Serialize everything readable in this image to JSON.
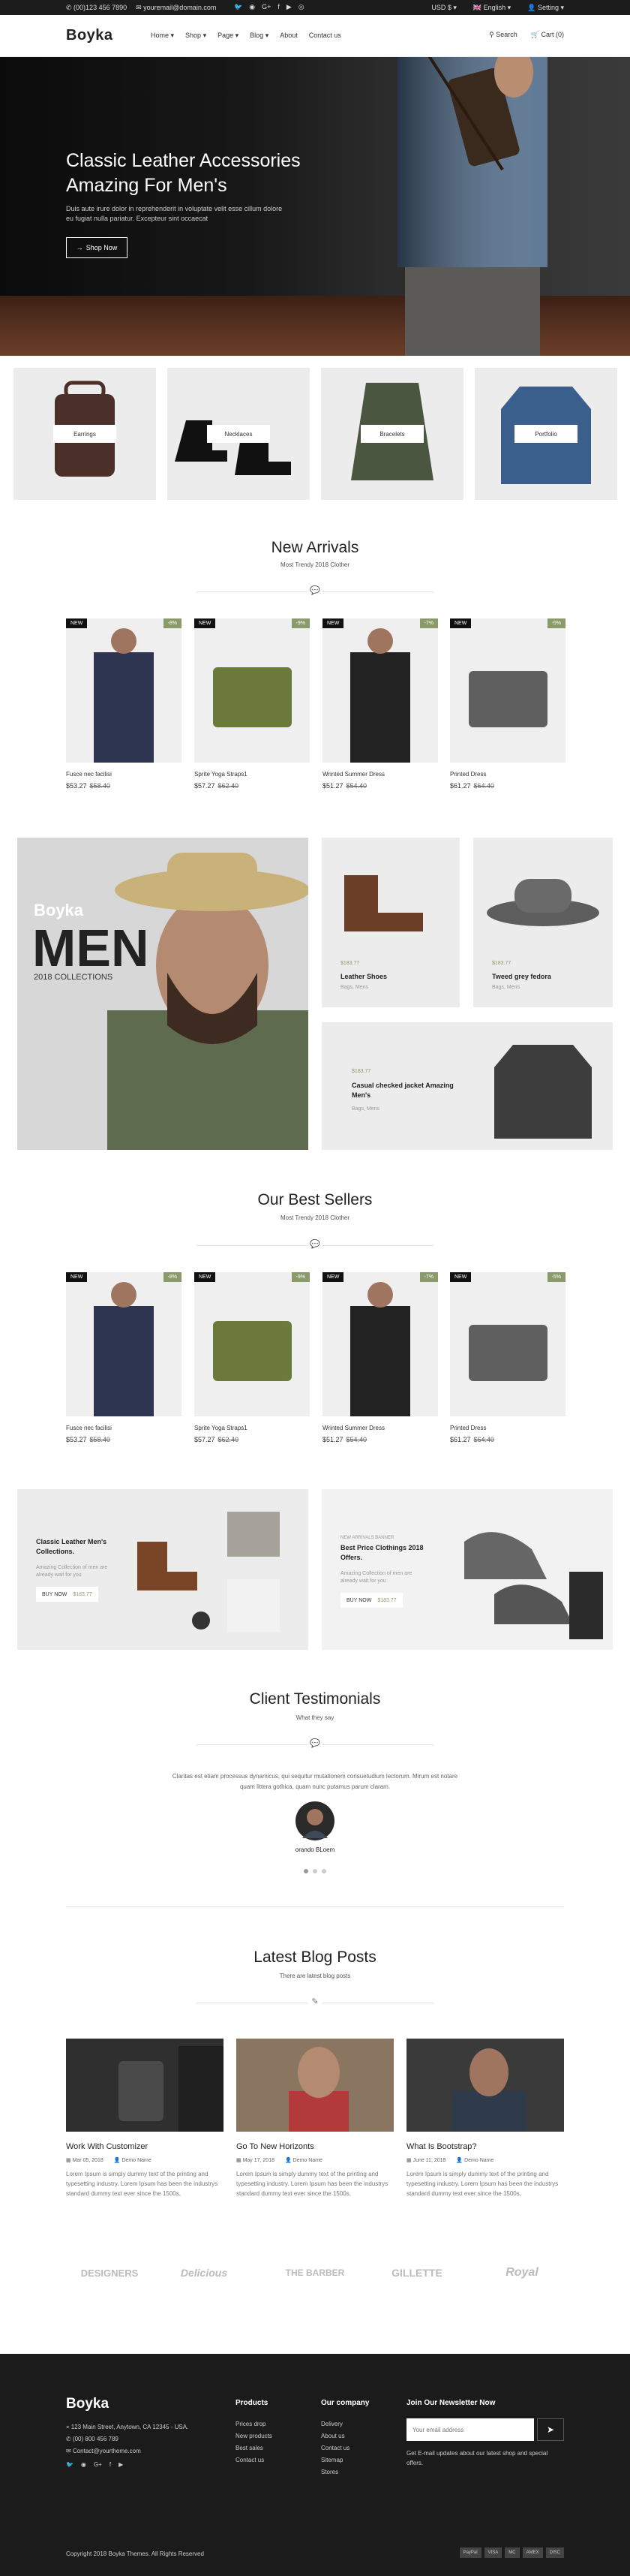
{
  "topbar": {
    "phone": "(00)123 456 7890",
    "email": "youremail@domain.com",
    "currency": "USD $",
    "language": "English",
    "setting": "Setting"
  },
  "header": {
    "logo": "Boyka",
    "nav": [
      "Home",
      "Shop",
      "Page",
      "Blog",
      "About",
      "Contact us"
    ],
    "search": "Search",
    "cart": "Cart (0)"
  },
  "hero": {
    "title": "Classic Leather Accessories Amazing For Men's",
    "text": "Duis aute irure dolor in reprehenderit in voluptate velit esse cillum dolore eu fugiat nulla pariatur. Excepteur sint occaecat",
    "button": "Shop Now"
  },
  "categories": [
    "Earrings",
    "Necklaces",
    "Bracelets",
    "Portfolio"
  ],
  "new_arrivals": {
    "title": "New Arrivals",
    "subtitle": "Most Trendy 2018 Clother",
    "products": [
      {
        "name": "Fusce nec facilisi",
        "price": "$53.27",
        "old": "$58.40",
        "badge": "NEW",
        "off": "-8%"
      },
      {
        "name": "Sprite Yoga Straps1",
        "price": "$57.27",
        "old": "$62.40",
        "badge": "NEW",
        "off": "-9%"
      },
      {
        "name": "Wrinted Summer Dress",
        "price": "$51.27",
        "old": "$54.40",
        "badge": "NEW",
        "off": "-7%"
      },
      {
        "name": "Printed Dress",
        "price": "$61.27",
        "old": "$64.40",
        "badge": "NEW",
        "off": "-5%"
      }
    ]
  },
  "men_banner": {
    "brand": "Boyka",
    "word": "MEN",
    "sub": "2018 COLLECTIONS"
  },
  "promos": [
    {
      "price": "$183.77",
      "title": "Leather Shoes",
      "sub": "Bags, Mens"
    },
    {
      "price": "$183.77",
      "title": "Tweed grey fedora",
      "sub": "Bags, Mens"
    },
    {
      "price": "$183.77",
      "title": "Casual checked jacket Amazing Men's",
      "sub": "Bags, Mens"
    }
  ],
  "best_sellers": {
    "title": "Our Best Sellers",
    "subtitle": "Most Trendy 2018 Clother",
    "products": [
      {
        "name": "Fusce nec facilisi",
        "price": "$53.27",
        "old": "$58.40",
        "badge": "NEW",
        "off": "-8%"
      },
      {
        "name": "Sprite Yoga Straps1",
        "price": "$57.27",
        "old": "$62.40",
        "badge": "NEW",
        "off": "-9%"
      },
      {
        "name": "Wrinted Summer Dress",
        "price": "$51.27",
        "old": "$54.40",
        "badge": "NEW",
        "off": "-7%"
      },
      {
        "name": "Printed Dress",
        "price": "$61.27",
        "old": "$64.40",
        "badge": "NEW",
        "off": "-5%"
      }
    ]
  },
  "offers": [
    {
      "title": "Classic Leather Men's Collections.",
      "text": "Amazing Collection of men are already wait for you",
      "button": "BUY NOW",
      "price": "$183.77",
      "kicker": ""
    },
    {
      "title": "Best Price Clothings 2018 Offers.",
      "text": "Amazing Collection of men are already wait for you",
      "button": "BUY NOW",
      "price": "$183.77",
      "kicker": "NEW ARRIVALS BANNER"
    }
  ],
  "testimonials": {
    "title": "Client Testimonials",
    "subtitle": "What they say",
    "quote": "Claritas est etiam processus dynamicus, qui sequitur mutationem consuetudium lectorum. Mirum est notare quam littera gothica, quam nunc putamus parum claram.",
    "author": "orando BLoem"
  },
  "blog": {
    "title": "Latest Blog Posts",
    "subtitle": "There are latest blog posts",
    "posts": [
      {
        "title": "Work With Customizer",
        "date": "Mar 05, 2018",
        "author": "Demo Name",
        "excerpt": "Lorem Ipsum is simply dummy text of the printing and typesetting industry. Lorem Ipsum has been the industrys standard dummy text ever since the 1500s,"
      },
      {
        "title": "Go To New Horizonts",
        "date": "May 17, 2018",
        "author": "Demo Name",
        "excerpt": "Lorem Ipsum is simply dummy text of the printing and typesetting industry. Lorem Ipsum has been the industrys standard dummy text ever since the 1500s,"
      },
      {
        "title": "What Is Bootstrap?",
        "date": "June 11, 2018",
        "author": "Demo Name",
        "excerpt": "Lorem Ipsum is simply dummy text of the printing and typesetting industry. Lorem Ipsum has been the industrys standard dummy text ever since the 1500s,"
      }
    ]
  },
  "brands": [
    "DESIGNERS",
    "Delicious",
    "THE BARBER",
    "GILLETTE",
    "Royal"
  ],
  "footer": {
    "logo": "Boyka",
    "address": "123 Main Street, Anytown, CA 12345 - USA.",
    "phone": "(00) 800 456 789",
    "email": "Contact@yourtheme.com",
    "products_title": "Products",
    "products": [
      "Prices drop",
      "New products",
      "Best sales",
      "Contact us"
    ],
    "company_title": "Our company",
    "company": [
      "Delivery",
      "About us",
      "Contact us",
      "Sitemap",
      "Stores"
    ],
    "newsletter_title": "Join Our Newsletter Now",
    "newsletter_placeholder": "Your email address",
    "newsletter_text": "Get E-mail updates about our latest shop and special offers.",
    "copyright": "Copyright 2018 Boyka Themes. All Rights Reserved",
    "payments": [
      "PayPal",
      "VISA",
      "MC",
      "AMEX",
      "DISC"
    ]
  },
  "colors": {
    "accent": "#8a9a6b",
    "dark": "#1b1b1b",
    "tile": "#ececec"
  }
}
